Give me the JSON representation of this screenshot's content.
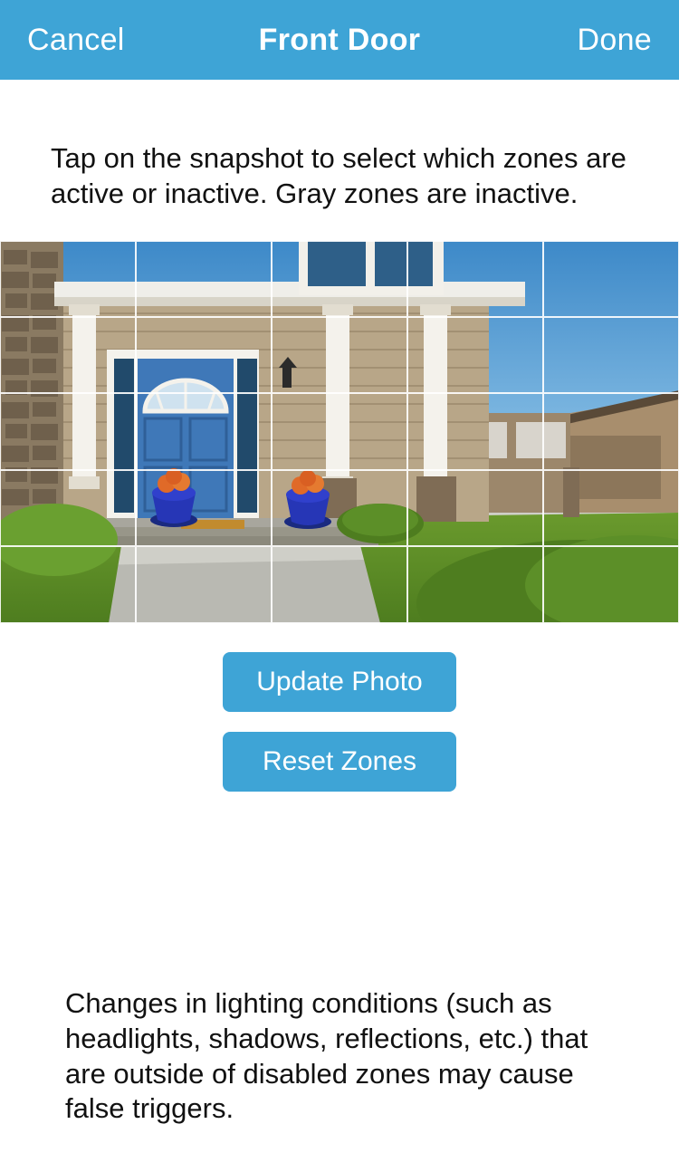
{
  "nav": {
    "cancel": "Cancel",
    "title": "Front Door",
    "done": "Done"
  },
  "instructions": "Tap on the snapshot to select which zones are active or inactive. Gray zones are inactive.",
  "grid": {
    "rows": 5,
    "cols": 5
  },
  "actions": {
    "update_photo": "Update Photo",
    "reset_zones": "Reset Zones"
  },
  "footer_note": "Changes in lighting conditions (such as headlights, shadows, reflections, etc.) that are outside of disabled zones may cause false triggers."
}
